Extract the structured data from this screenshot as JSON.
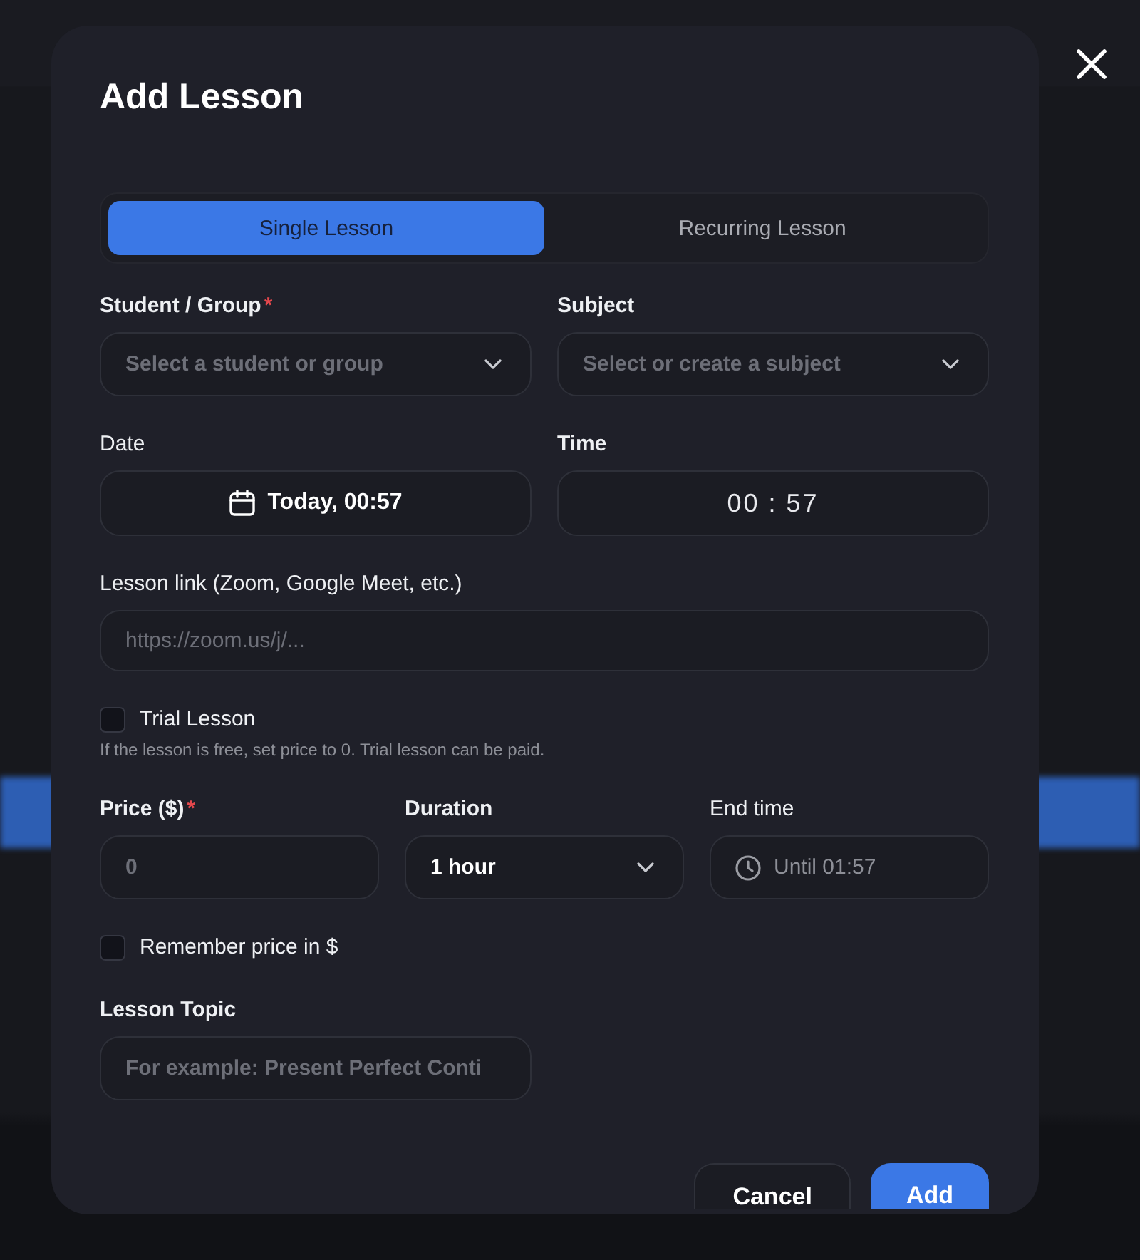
{
  "dialog": {
    "title": "Add Lesson"
  },
  "tabs": [
    {
      "label": "Single Lesson",
      "selected": true
    },
    {
      "label": "Recurring Lesson",
      "selected": false
    }
  ],
  "form_rows": [
    {
      "kind": "fields",
      "fields": [
        {
          "kind": "select",
          "label": "Student / Group",
          "required_mark": "*",
          "placeholder": "Select a student or group"
        },
        {
          "kind": "select",
          "label": "Subject",
          "placeholder": "Select or create a subject"
        }
      ]
    },
    {
      "kind": "fields",
      "fields": [
        {
          "kind": "date",
          "label": "Date",
          "value": "Today, 00:57"
        },
        {
          "kind": "time",
          "label": "Time",
          "hours": "00",
          "separator": ":",
          "minutes": "57"
        }
      ]
    },
    {
      "kind": "fields",
      "fields": [
        {
          "kind": "url",
          "label": "Lesson link (Zoom, Google Meet, etc.)",
          "placeholder": "https://zoom.us/j/..."
        }
      ]
    },
    {
      "kind": "checkbox",
      "label": "Trial Lesson",
      "checked": false,
      "hint": "If the lesson is free, set price to 0. Trial lesson can be paid."
    },
    {
      "kind": "fields",
      "fields": [
        {
          "kind": "number",
          "label": "Price ($)",
          "required_mark": "*",
          "placeholder": "0"
        },
        {
          "kind": "select",
          "label": "Duration",
          "value": "1 hour"
        },
        {
          "kind": "end_time",
          "label": "End time",
          "value": "Until 01:57",
          "disabled": true
        }
      ]
    },
    {
      "kind": "checkbox",
      "label": "Remember price in $",
      "checked": false
    },
    {
      "kind": "fields",
      "fields": [
        {
          "kind": "text",
          "label": "Lesson Topic",
          "placeholder": "For example: Present Perfect Conti"
        }
      ]
    }
  ],
  "footer_buttons": [
    {
      "kind": "cancel",
      "label": "Cancel"
    },
    {
      "kind": "submit",
      "label": "Add"
    }
  ]
}
